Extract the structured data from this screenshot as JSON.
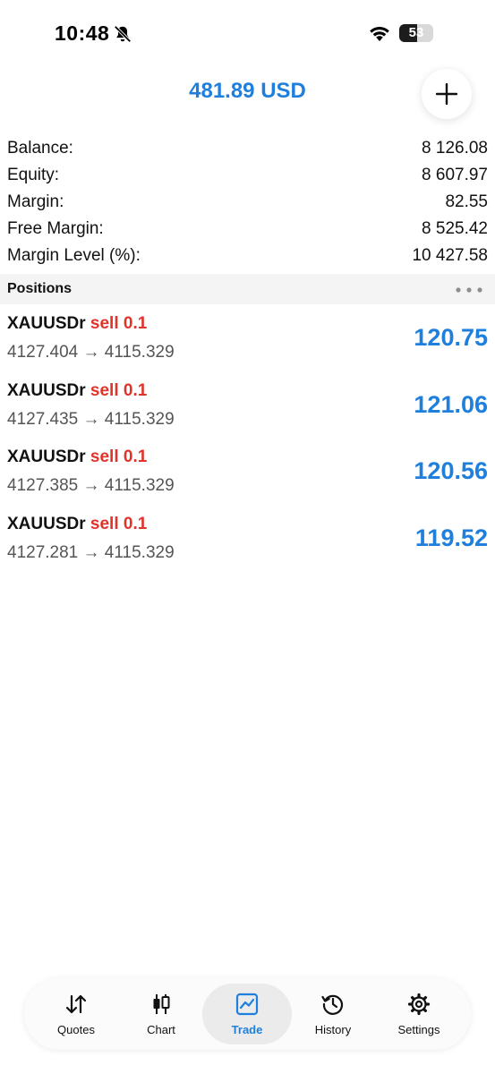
{
  "status_bar": {
    "time": "10:48",
    "battery": "53",
    "battery_level": 0.53
  },
  "header": {
    "title": "481.89 USD"
  },
  "summary": [
    {
      "label": "Balance:",
      "value": "8 126.08"
    },
    {
      "label": "Equity:",
      "value": "8 607.97"
    },
    {
      "label": "Margin:",
      "value": "82.55"
    },
    {
      "label": "Free Margin:",
      "value": "8 525.42"
    },
    {
      "label": "Margin Level (%):",
      "value": "10 427.58"
    }
  ],
  "positions": {
    "title": "Positions",
    "items": [
      {
        "symbol": "XAUUSDr",
        "side": "sell 0.1",
        "prices": "4127.404 → 4115.329",
        "profit": "120.75"
      },
      {
        "symbol": "XAUUSDr",
        "side": "sell 0.1",
        "prices": "4127.435 → 4115.329",
        "profit": "121.06"
      },
      {
        "symbol": "XAUUSDr",
        "side": "sell 0.1",
        "prices": "4127.385 → 4115.329",
        "profit": "120.56"
      },
      {
        "symbol": "XAUUSDr",
        "side": "sell 0.1",
        "prices": "4127.281 → 4115.329",
        "profit": "119.52"
      }
    ]
  },
  "tabs": [
    {
      "label": "Quotes",
      "icon": "quotes-arrows-icon"
    },
    {
      "label": "Chart",
      "icon": "candlestick-icon"
    },
    {
      "label": "Trade",
      "icon": "trade-chart-icon",
      "active": true
    },
    {
      "label": "History",
      "icon": "history-clock-icon"
    },
    {
      "label": "Settings",
      "icon": "gear-icon"
    }
  ],
  "colors": {
    "accent": "#1f7fdc",
    "sell": "#e0332a"
  }
}
